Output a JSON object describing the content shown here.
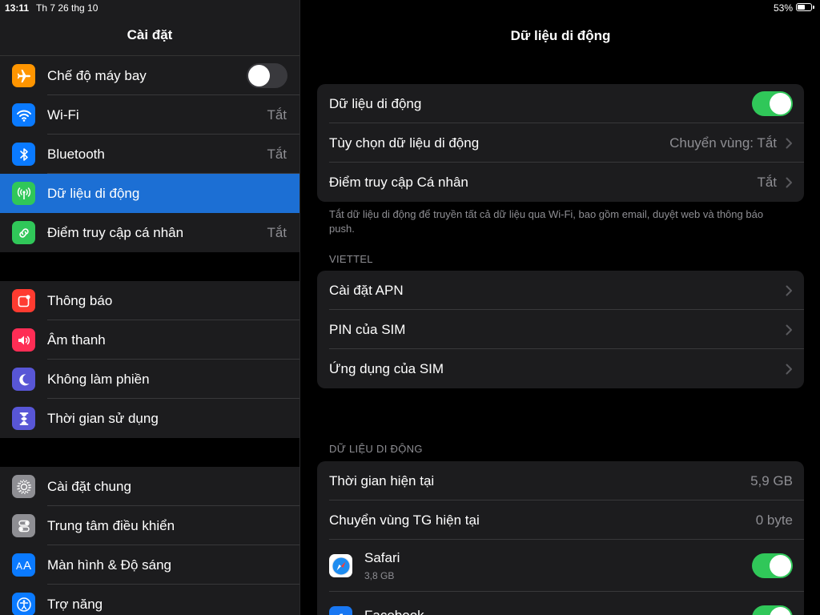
{
  "status": {
    "time": "13:11",
    "date": "Th 7 26 thg 10",
    "battery": "53%",
    "battery_level": 0.53
  },
  "sidebar": {
    "title": "Cài đặt",
    "groups": [
      [
        {
          "label": "Chế độ máy bay",
          "icon": "airplane-icon",
          "color": "#ff9500",
          "toggle": false
        },
        {
          "label": "Wi-Fi",
          "icon": "wifi-icon",
          "color": "#0a7aff",
          "value": "Tắt"
        },
        {
          "label": "Bluetooth",
          "icon": "bluetooth-icon",
          "color": "#0a7aff",
          "value": "Tắt"
        },
        {
          "label": "Dữ liệu di động",
          "icon": "antenna-icon",
          "color": "#30c759",
          "selected": true
        },
        {
          "label": "Điểm truy cập cá nhân",
          "icon": "hotspot-icon",
          "color": "#30c759",
          "value": "Tắt"
        }
      ],
      [
        {
          "label": "Thông báo",
          "icon": "notification-icon",
          "color": "#ff3b30"
        },
        {
          "label": "Âm thanh",
          "icon": "speaker-icon",
          "color": "#ff2d55"
        },
        {
          "label": "Không làm phiền",
          "icon": "moon-icon",
          "color": "#5856d6"
        },
        {
          "label": "Thời gian sử dụng",
          "icon": "hourglass-icon",
          "color": "#5856d6"
        }
      ],
      [
        {
          "label": "Cài đặt chung",
          "icon": "gear-icon",
          "color": "#8e8e93"
        },
        {
          "label": "Trung tâm điều khiển",
          "icon": "switches-icon",
          "color": "#8e8e93"
        },
        {
          "label": "Màn hình & Độ sáng",
          "icon": "text-size-icon",
          "color": "#0a7aff"
        },
        {
          "label": "Trợ năng",
          "icon": "accessibility-icon",
          "color": "#0a7aff"
        }
      ]
    ]
  },
  "main": {
    "title": "Dữ liệu di động",
    "card1": {
      "cellular_label": "Dữ liệu di động",
      "cellular_on": true,
      "options_label": "Tùy chọn dữ liệu di động",
      "options_value": "Chuyển vùng: Tắt",
      "hotspot_label": "Điểm truy cập Cá nhân",
      "hotspot_value": "Tắt"
    },
    "footnote": "Tắt dữ liệu di động để truyền tất cả dữ liệu qua Wi-Fi, bao gồm email, duyệt web và thông báo push.",
    "carrier_header": "VIETTEL",
    "carrier_rows": [
      "Cài đặt APN",
      "PIN của SIM",
      "Ứng dụng của SIM"
    ],
    "usage_header": "DỮ LIỆU DI ĐỘNG",
    "usage": {
      "current_label": "Thời gian hiện tại",
      "current_value": "5,9 GB",
      "roaming_label": "Chuyển vùng TG hiện tại",
      "roaming_value": "0 byte"
    },
    "apps": [
      {
        "name": "Safari",
        "size": "3,8 GB",
        "icon": "safari-icon",
        "on": true
      },
      {
        "name": "Facebook",
        "size": "",
        "icon": "facebook-icon",
        "on": true
      }
    ]
  }
}
